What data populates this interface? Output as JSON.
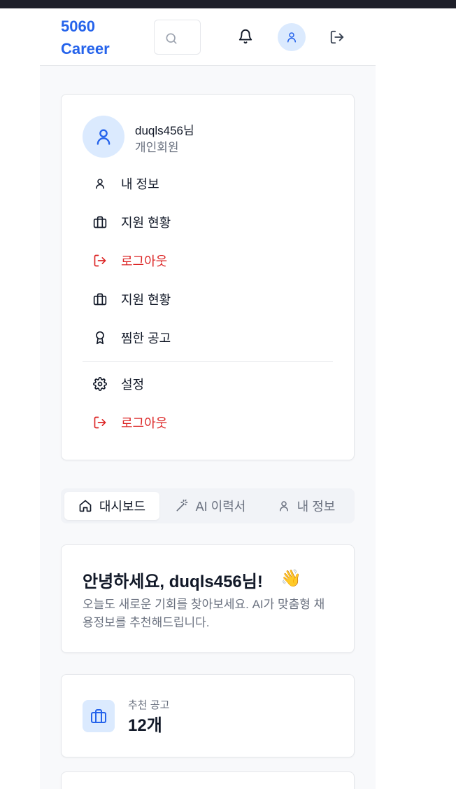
{
  "header": {
    "brand_line1": "5060",
    "brand_line2": "Career"
  },
  "profile": {
    "name": "duqls456님",
    "type": "개인회원"
  },
  "menu": {
    "items": [
      {
        "label": "내 정보",
        "icon": "user-icon"
      },
      {
        "label": "지원 현황",
        "icon": "briefcase-icon"
      },
      {
        "label": "로그아웃",
        "icon": "logout-icon"
      },
      {
        "label": "지원 현황",
        "icon": "briefcase-icon"
      },
      {
        "label": "찜한 공고",
        "icon": "award-icon"
      },
      {
        "label": "설정",
        "icon": "gear-icon"
      },
      {
        "label": "로그아웃",
        "icon": "logout-icon"
      }
    ]
  },
  "tabs": [
    {
      "label": "대시보드",
      "icon": "home-icon",
      "active": true
    },
    {
      "label": "AI 이력서",
      "icon": "magic-wand-icon",
      "active": false
    },
    {
      "label": "내 정보",
      "icon": "user-icon",
      "active": false
    }
  ],
  "welcome": {
    "title": "안녕하세요, duqls456님!",
    "emoji": "👋",
    "description": "오늘도 새로운 기회를 찾아보세요. AI가 맞춤형 채용정보를 추천해드립니다."
  },
  "stats": {
    "recommended_label": "추천 공고",
    "recommended_value": "12개"
  },
  "colors": {
    "brand": "#2563eb",
    "danger": "#dc2626",
    "avatar_bg": "#dbeafe",
    "muted_text": "#6b7280"
  }
}
